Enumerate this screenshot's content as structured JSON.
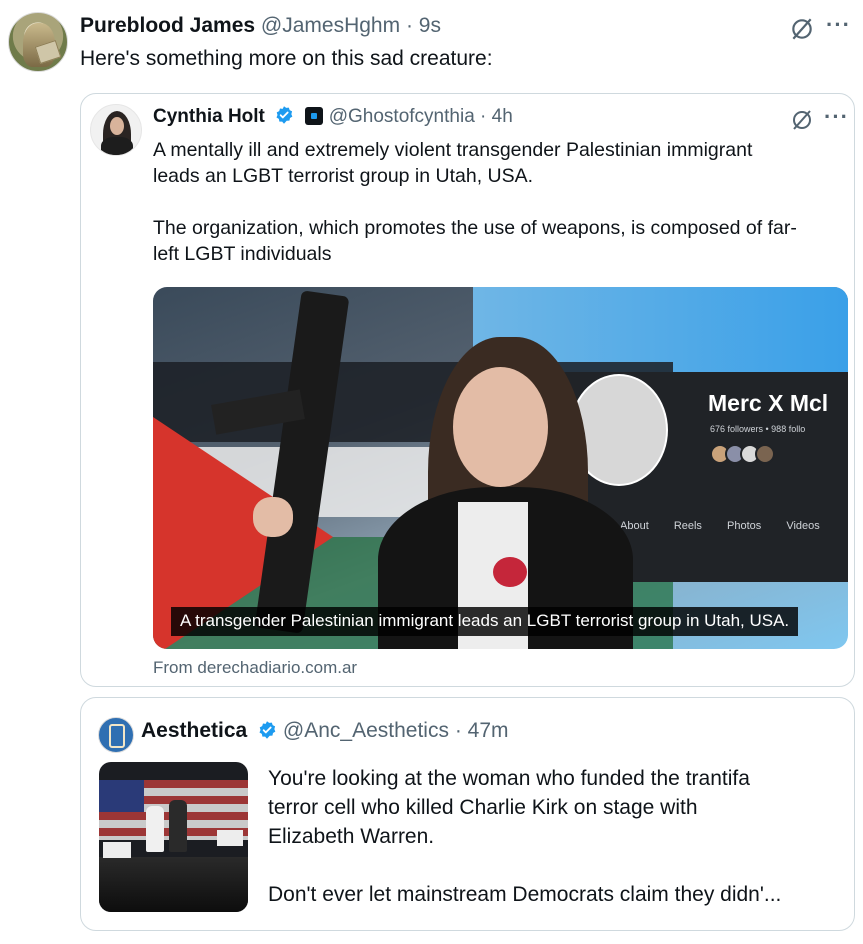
{
  "main_tweet": {
    "name": "Pureblood James",
    "handle": "@JamesHghm",
    "separator": "·",
    "time": "9s",
    "text": "Here's something more on this sad creature:"
  },
  "quoted_tweet_1": {
    "name": "Cynthia Holt",
    "handle": "@Ghostofcynthia",
    "separator": "·",
    "time": "4h",
    "paragraph_1_line_1": "A mentally ill and extremely violent transgender Palestinian immigrant",
    "paragraph_1_line_2": "leads an LGBT terrorist group in Utah, USA.",
    "paragraph_2_line_1": "The organization, which promotes the use of weapons, is composed of far-",
    "paragraph_2_line_2": "left LGBT individuals",
    "media": {
      "caption": "A transgender Palestinian immigrant leads an LGBT terrorist group in Utah, USA.",
      "profile_name": "Merc X Mcl",
      "profile_followers": "676 followers • 988 follo",
      "profile_tabs": [
        "About",
        "Reels",
        "Photos",
        "Videos"
      ]
    },
    "source": "From derechadiario.com.ar"
  },
  "quoted_tweet_2": {
    "name": "Aesthetica",
    "handle": "@Anc_Aesthetics",
    "separator": "·",
    "time": "47m",
    "line_1": "You're looking at the woman who funded the trantifa",
    "line_2": "terror cell who killed Charlie Kirk on stage with",
    "line_3": "Elizabeth Warren.",
    "line_4": "Don't ever let mainstream Democrats claim they didn'..."
  },
  "icons": {
    "grok": "grok-icon",
    "more": "more-icon",
    "verified": "verified-badge-icon",
    "more_glyph": "···"
  },
  "colors": {
    "verified_blue": "#1d9bf0",
    "muted_text": "#536471",
    "border": "#cfd9de"
  }
}
